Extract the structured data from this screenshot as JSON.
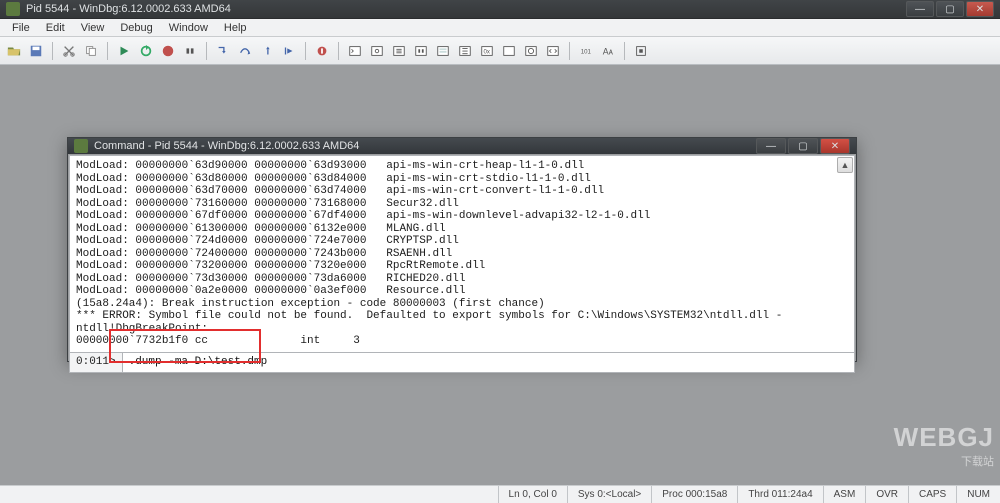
{
  "window": {
    "title": "Pid 5544 - WinDbg:6.12.0002.633 AMD64",
    "controls": {
      "min": "—",
      "max": "▢",
      "close": "✕"
    }
  },
  "menubar": [
    "File",
    "Edit",
    "View",
    "Debug",
    "Window",
    "Help"
  ],
  "inner_window": {
    "title": "Command - Pid 5544 - WinDbg:6.12.0002.633 AMD64",
    "controls": {
      "min": "—",
      "max": "▢",
      "close": "✕"
    }
  },
  "output_text": "ModLoad: 00000000`63d90000 00000000`63d93000   api-ms-win-crt-heap-l1-1-0.dll\nModLoad: 00000000`63d80000 00000000`63d84000   api-ms-win-crt-stdio-l1-1-0.dll\nModLoad: 00000000`63d70000 00000000`63d74000   api-ms-win-crt-convert-l1-1-0.dll\nModLoad: 00000000`73160000 00000000`73168000   Secur32.dll\nModLoad: 00000000`67df0000 00000000`67df4000   api-ms-win-downlevel-advapi32-l2-1-0.dll\nModLoad: 00000000`61300000 00000000`6132e000   MLANG.dll\nModLoad: 00000000`724d0000 00000000`724e7000   CRYPTSP.dll\nModLoad: 00000000`72400000 00000000`7243b000   RSAENH.dll\nModLoad: 00000000`73200000 00000000`7320e000   RpcRtRemote.dll\nModLoad: 00000000`73d30000 00000000`73da6000   RICHED20.dll\nModLoad: 00000000`0a2e0000 00000000`0a3ef000   Resource.dll\n(15a8.24a4): Break instruction exception - code 80000003 (first chance)\n*** ERROR: Symbol file could not be found.  Defaulted to export symbols for C:\\Windows\\SYSTEM32\\ntdll.dll - \nntdll!DbgBreakPoint:\n00000000`7732b1f0 cc              int     3",
  "prompt": {
    "label": "0:011>",
    "value": ".dump -ma D:\\test.dmp"
  },
  "statusbar": {
    "lncol": "Ln 0, Col 0",
    "sys": "Sys 0:<Local>",
    "proc": "Proc 000:15a8",
    "thrd": "Thrd 011:24a4",
    "asm": "ASM",
    "ovr": "OVR",
    "caps": "CAPS",
    "num": "NUM"
  },
  "watermark": {
    "main": "WEBGJ",
    "sub": "下载站"
  },
  "icons": {
    "scroll_up": "▲"
  }
}
